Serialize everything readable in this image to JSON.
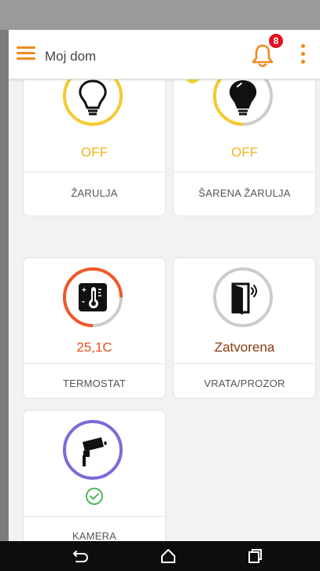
{
  "app": {
    "title": "Moj dom",
    "notification_count": "8",
    "accent": "#f08a1c"
  },
  "devices": [
    {
      "name": "ŽARULJA",
      "state": "OFF",
      "state_color": "#f2b316",
      "ring_color": "#f5c930",
      "icon": "lightbulb-outline-icon"
    },
    {
      "name": "ŠARENA ŽARULJA",
      "state": "OFF",
      "state_color": "#f2b316",
      "ring_color": "#f5c930",
      "icon": "lightbulb-filled-icon"
    },
    {
      "name": "TERMOSTAT",
      "state": "25,1C",
      "state_color": "#e8501b",
      "ring_color": "#f0582a",
      "icon": "thermostat-icon"
    },
    {
      "name": "VRATA/PROZOR",
      "state": "Zatvorena",
      "state_color": "#8a3a0e",
      "ring_color": "#cccccc",
      "icon": "door-sensor-icon"
    },
    {
      "name": "KAMERA",
      "state": "",
      "state_color": "#39b54a",
      "ring_color": "#7d6ad8",
      "icon": "security-camera-icon",
      "status_icon": "check-circle-icon"
    }
  ],
  "nav": {
    "icons": [
      "back-icon",
      "home-icon",
      "recent-apps-icon"
    ]
  }
}
